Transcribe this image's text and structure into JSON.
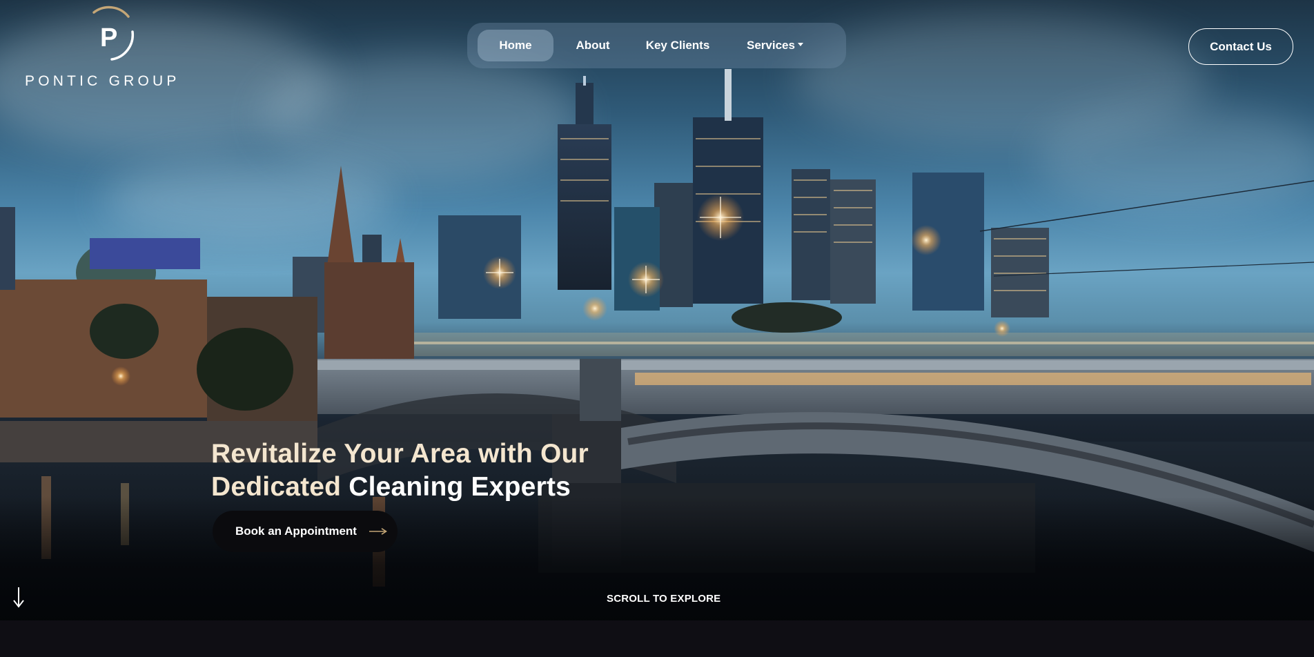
{
  "brand": {
    "logo_letter": "P",
    "name": "PONTIC GROUP",
    "accent_color": "#c4a677"
  },
  "nav": {
    "items": [
      {
        "label": "Home",
        "active": true
      },
      {
        "label": "About",
        "active": false
      },
      {
        "label": "Key Clients",
        "active": false
      },
      {
        "label": "Services",
        "active": false,
        "has_dropdown": true
      }
    ]
  },
  "header": {
    "contact_label": "Contact Us"
  },
  "hero": {
    "headline_line1": "Revitalize Your Area with Our",
    "headline_line2_plain": "Dedicated ",
    "headline_line2_strong": "Cleaning Experts",
    "cta_label": "Book an Appointment",
    "cta_icon": "arrow-right-icon",
    "scroll_label": "SCROLL TO EXPLORE",
    "scroll_icon": "arrow-down-icon",
    "background_image": "city-skyline-bridge-dusk"
  }
}
